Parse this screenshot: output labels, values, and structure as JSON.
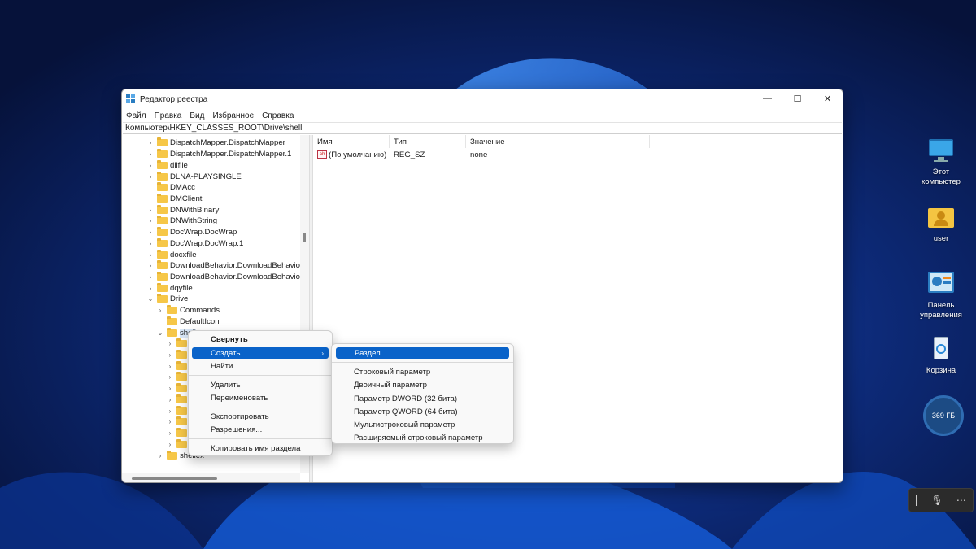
{
  "window": {
    "title": "Редактор реестра",
    "controls": {
      "minimize": "—",
      "maximize": "☐",
      "close": "✕"
    }
  },
  "menubar": [
    "Файл",
    "Правка",
    "Вид",
    "Избранное",
    "Справка"
  ],
  "address": "Компьютер\\HKEY_CLASSES_ROOT\\Drive\\shell",
  "tree": [
    {
      "label": "DispatchMapper.DispatchMapper",
      "expander": ">"
    },
    {
      "label": "DispatchMapper.DispatchMapper.1",
      "expander": ">"
    },
    {
      "label": "dllfile",
      "expander": ">"
    },
    {
      "label": "DLNA-PLAYSINGLE",
      "expander": ">"
    },
    {
      "label": "DMAcc",
      "expander": ""
    },
    {
      "label": "DMClient",
      "expander": ""
    },
    {
      "label": "DNWithBinary",
      "expander": ">"
    },
    {
      "label": "DNWithString",
      "expander": ">"
    },
    {
      "label": "DocWrap.DocWrap",
      "expander": ">"
    },
    {
      "label": "DocWrap.DocWrap.1",
      "expander": ">"
    },
    {
      "label": "docxfile",
      "expander": ">"
    },
    {
      "label": "DownloadBehavior.DownloadBehavior",
      "expander": ">"
    },
    {
      "label": "DownloadBehavior.DownloadBehavior.",
      "expander": ">"
    },
    {
      "label": "dqyfile",
      "expander": ">"
    },
    {
      "label": "Drive",
      "expander": "v"
    },
    {
      "label": "Commands",
      "expander": ">"
    },
    {
      "label": "DefaultIcon",
      "expander": ""
    },
    {
      "label": "shell",
      "expander": "v"
    },
    {
      "label": "",
      "expander": ">"
    },
    {
      "label": "",
      "expander": ">"
    },
    {
      "label": "",
      "expander": ">"
    },
    {
      "label": "",
      "expander": ">"
    },
    {
      "label": "",
      "expander": ">"
    },
    {
      "label": "",
      "expander": ">"
    },
    {
      "label": "",
      "expander": ">"
    },
    {
      "label": "",
      "expander": ">"
    },
    {
      "label": "",
      "expander": ">"
    },
    {
      "label": "",
      "expander": ">"
    },
    {
      "label": "shellex",
      "expander": ">"
    }
  ],
  "values_pane": {
    "columns": [
      "Имя",
      "Тип",
      "Значение"
    ],
    "rows": [
      {
        "name": "(По умолчанию)",
        "type": "REG_SZ",
        "value": "none",
        "icon": "string-value-icon"
      }
    ]
  },
  "context_menu": {
    "items": [
      "Свернуть",
      "Создать",
      "Найти...",
      "Удалить",
      "Переименовать",
      "Экспортировать",
      "Разрешения...",
      "Копировать имя раздела"
    ],
    "highlighted": "Создать"
  },
  "submenu": {
    "items": [
      "Раздел",
      "Строковый параметр",
      "Двоичный параметр",
      "Параметр DWORD (32 бита)",
      "Параметр QWORD (64 бита)",
      "Мультистроковый параметр",
      "Расширяемый строковый параметр"
    ],
    "highlighted": "Раздел"
  },
  "desktop": {
    "icons": [
      {
        "label_1": "Этот",
        "label_2": "компьютер",
        "icon": "monitor-icon"
      },
      {
        "label_1": "user",
        "label_2": "",
        "icon": "user-folder-icon"
      },
      {
        "label_1": "Панель",
        "label_2": "управления",
        "icon": "control-panel-icon"
      },
      {
        "label_1": "Корзина",
        "label_2": "",
        "icon": "recycle-bin-icon"
      }
    ],
    "disk_badge": "369 ГБ"
  },
  "colors": {
    "accent": "#0a63c9",
    "folder": "#f6c748",
    "wallpaper": "#0a1a4a"
  }
}
